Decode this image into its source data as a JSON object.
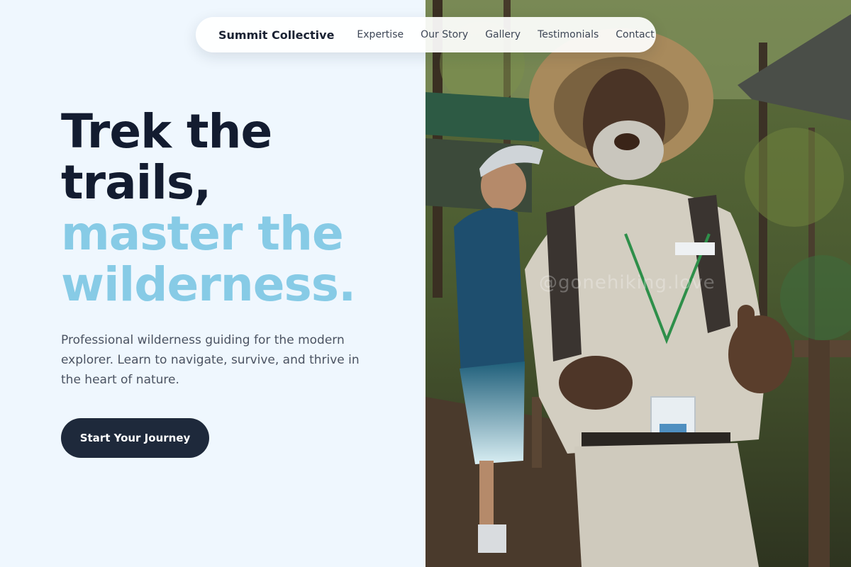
{
  "nav": {
    "brand": "Summit Collective",
    "links": [
      "Expertise",
      "Our Story",
      "Gallery",
      "Testimonials",
      "Contact"
    ]
  },
  "hero": {
    "headline_dark_1": "Trek the",
    "headline_dark_2": "trails,",
    "headline_light_1": "master the",
    "headline_light_2": "wilderness.",
    "subtitle": "Professional wilderness guiding for the modern explorer. Learn to navigate, survive, and thrive in the heart of nature.",
    "cta_label": "Start Your Journey",
    "photo_watermark": "@gonehiking.love"
  },
  "colors": {
    "dark_text": "#131c30",
    "accent_light": "#87cbe6",
    "button_bg": "#1e293b",
    "page_bg": "#eff7fe"
  }
}
